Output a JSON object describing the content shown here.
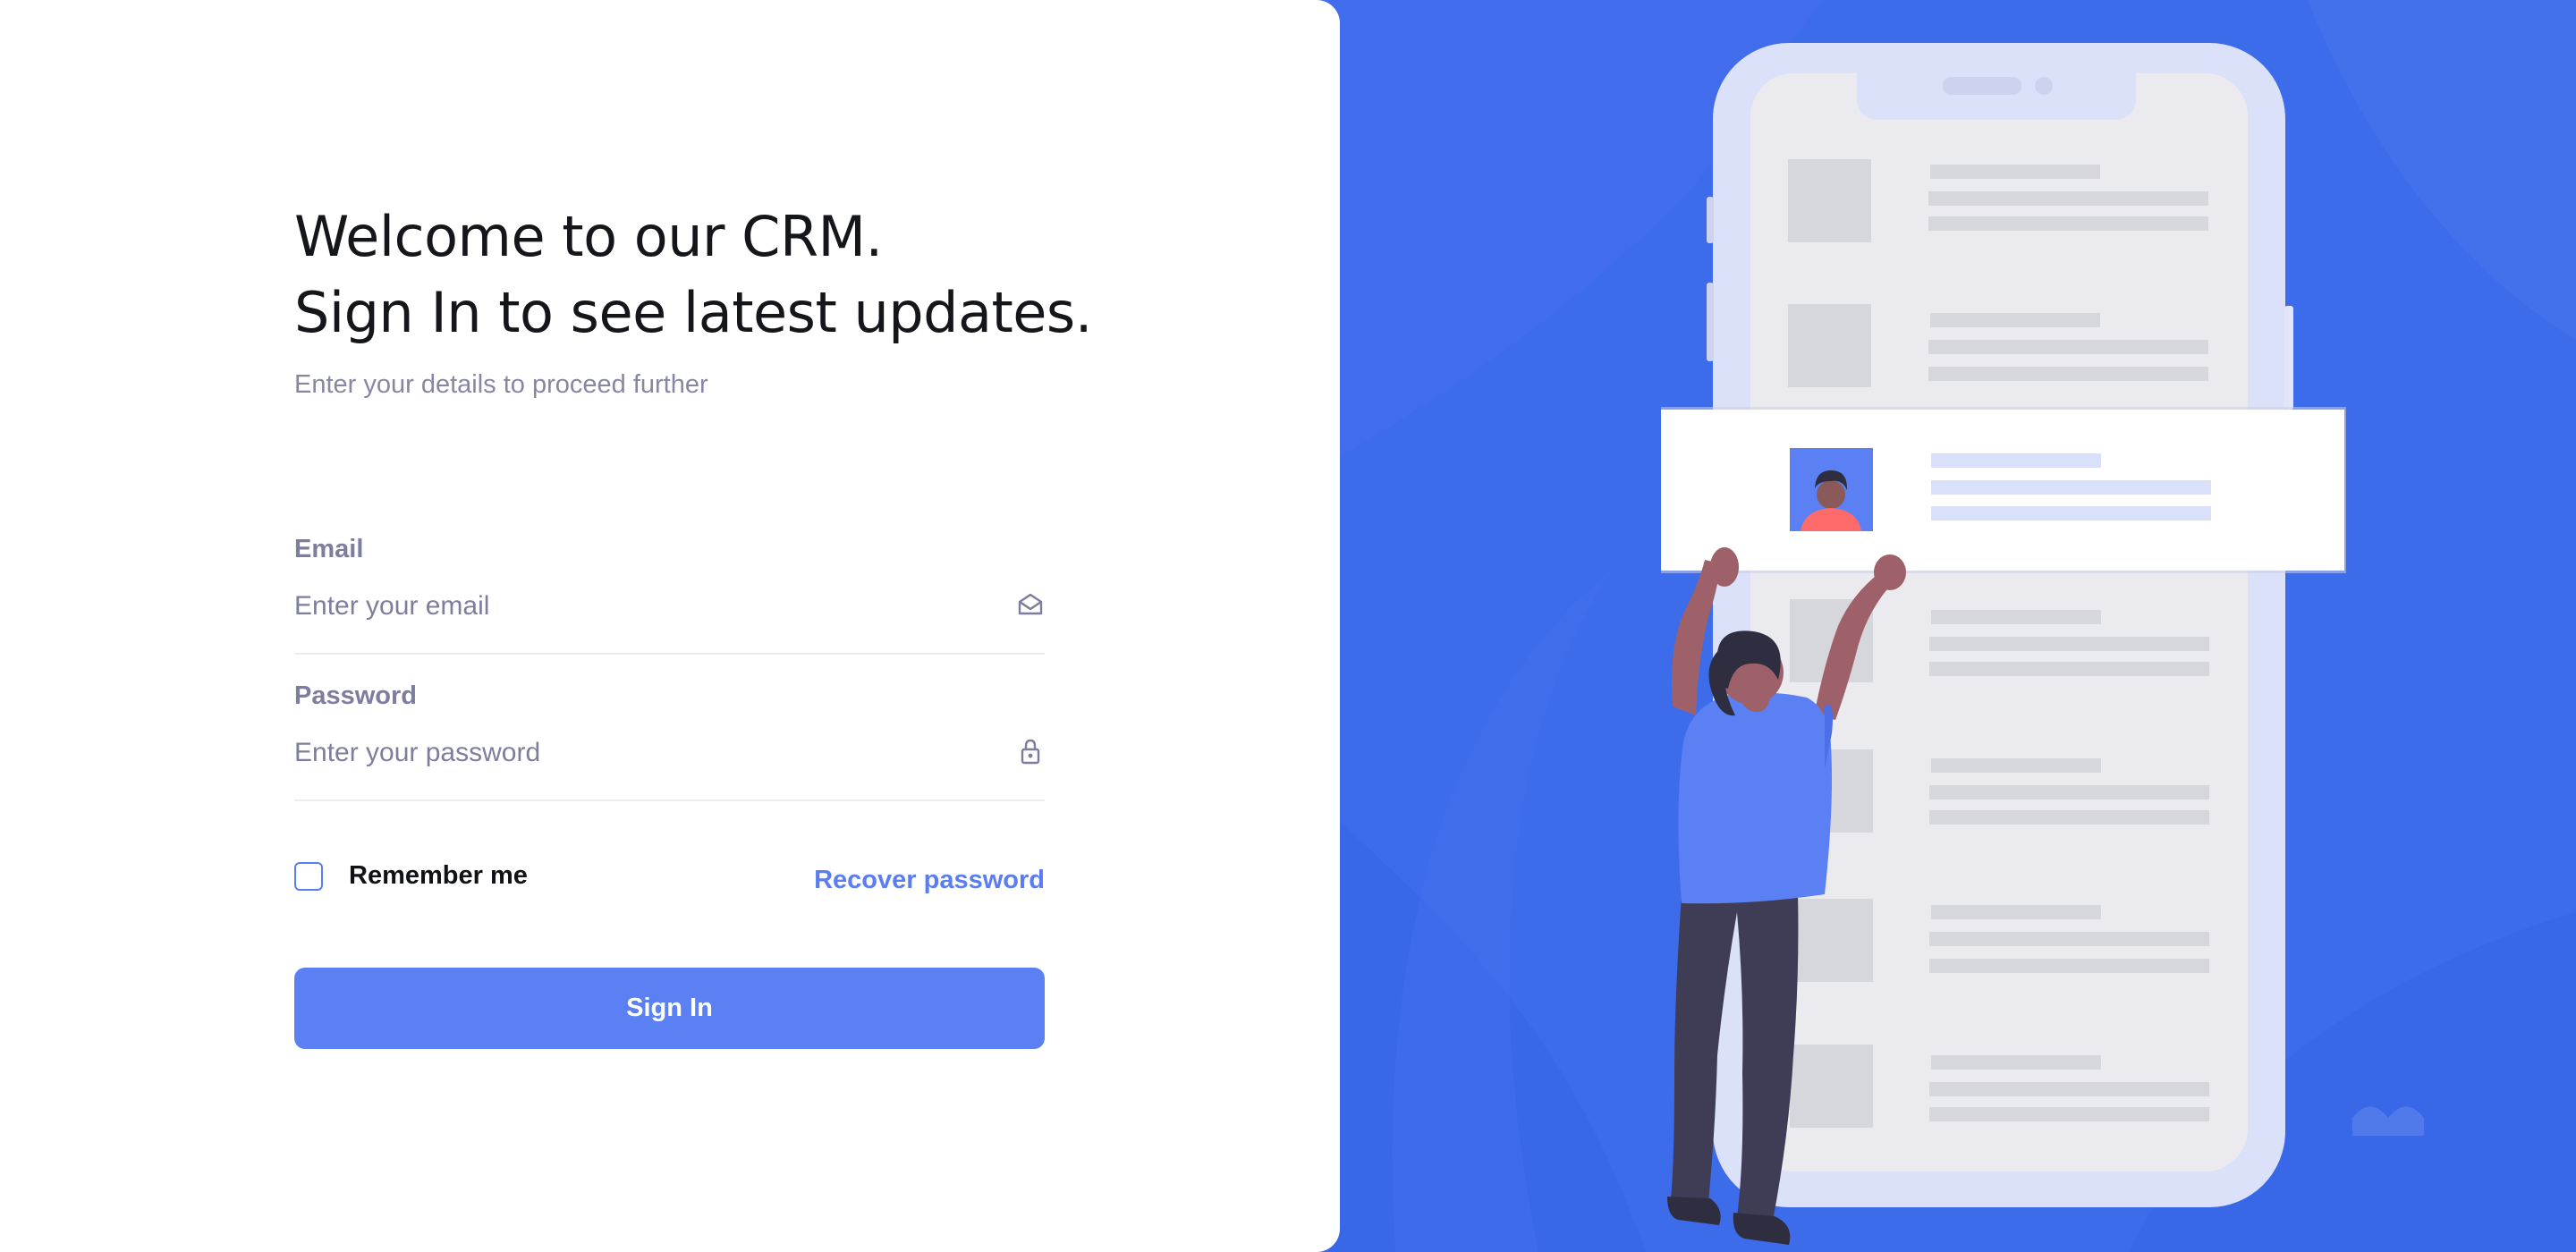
{
  "login": {
    "heading_line1": "Welcome to our CRM.",
    "heading_line2": "Sign In to see latest updates.",
    "subheading": "Enter your details to proceed further",
    "email": {
      "label": "Email",
      "placeholder": "Enter your email",
      "value": "",
      "icon": "envelope-icon"
    },
    "password": {
      "label": "Password",
      "placeholder": "Enter your password",
      "value": "",
      "icon": "lock-icon"
    },
    "remember_label": "Remember me",
    "remember_checked": false,
    "recover_label": "Recover password",
    "signin_label": "Sign In"
  },
  "colors": {
    "accent": "#5b80f3",
    "background": "#3d6cea",
    "label": "#7d7d9e",
    "heading": "#15161a"
  }
}
